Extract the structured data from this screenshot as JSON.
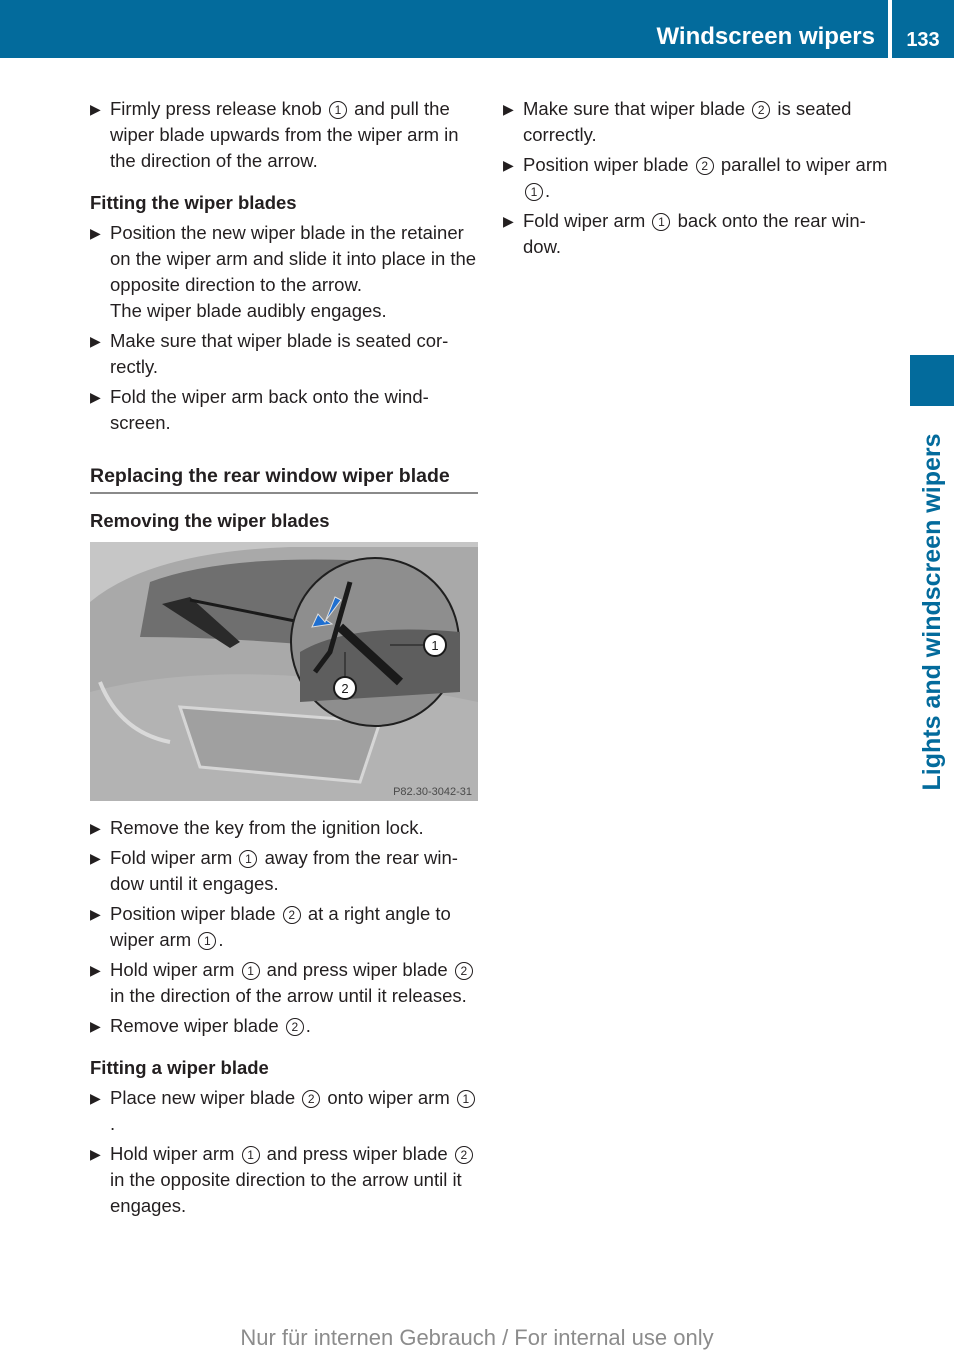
{
  "header": {
    "title": "Windscreen wipers",
    "page_number": "133",
    "color": "#036b9c"
  },
  "side_tab": {
    "label": "Lights and windscreen wipers"
  },
  "left_column": {
    "intro_step": {
      "parts": [
        "Firmly press release knob ",
        "1",
        " and pull the wiper blade upwards from the wiper arm in the direction of the arrow."
      ]
    },
    "fitting_blades": {
      "heading": "Fitting the wiper blades",
      "steps": [
        {
          "text": "Position the new wiper blade in the retainer on the wiper arm and slide it into place in the opposite direction to the arrow.",
          "note": "The wiper blade audibly engages."
        },
        {
          "text": "Make sure that wiper blade is seated cor-rectly."
        },
        {
          "text": "Fold the wiper arm back onto the wind-screen."
        }
      ]
    },
    "section": {
      "heading": "Replacing the rear window wiper blade",
      "removing_heading": "Removing the wiper blades",
      "figure": {
        "code": "P82.30-3042-31",
        "callouts": [
          "1",
          "2"
        ],
        "alt": "Rear window wiper arm with detail view of wiper blade and arrow"
      },
      "removing_steps": [
        {
          "parts": [
            "Remove the key from the ignition lock."
          ]
        },
        {
          "parts": [
            "Fold wiper arm ",
            "1",
            " away from the rear win-dow until it engages."
          ]
        },
        {
          "parts": [
            "Position wiper blade ",
            "2",
            " at a right angle to wiper arm ",
            "1",
            "."
          ]
        },
        {
          "parts": [
            "Hold wiper arm ",
            "1",
            " and press wiper blade ",
            "2",
            " in the direction of the arrow until it releases."
          ]
        },
        {
          "parts": [
            "Remove wiper blade ",
            "2",
            "."
          ]
        }
      ],
      "fitting_heading": "Fitting a wiper blade",
      "fitting_steps": [
        {
          "parts": [
            "Place new wiper blade ",
            "2",
            " onto wiper arm ",
            "1",
            "."
          ]
        },
        {
          "parts": [
            "Hold wiper arm ",
            "1",
            " and press wiper blade ",
            "2",
            " in the opposite direction to the arrow until it engages."
          ]
        }
      ]
    }
  },
  "right_column": {
    "steps": [
      {
        "parts": [
          "Make sure that wiper blade ",
          "2",
          " is seated correctly."
        ]
      },
      {
        "parts": [
          "Position wiper blade ",
          "2",
          " parallel to wiper arm ",
          "1",
          "."
        ]
      },
      {
        "parts": [
          "Fold wiper arm ",
          "1",
          " back onto the rear win-dow."
        ]
      }
    ]
  },
  "bullet_glyph": "▶",
  "footer": {
    "watermark": "Nur für internen Gebrauch / For internal use only"
  }
}
